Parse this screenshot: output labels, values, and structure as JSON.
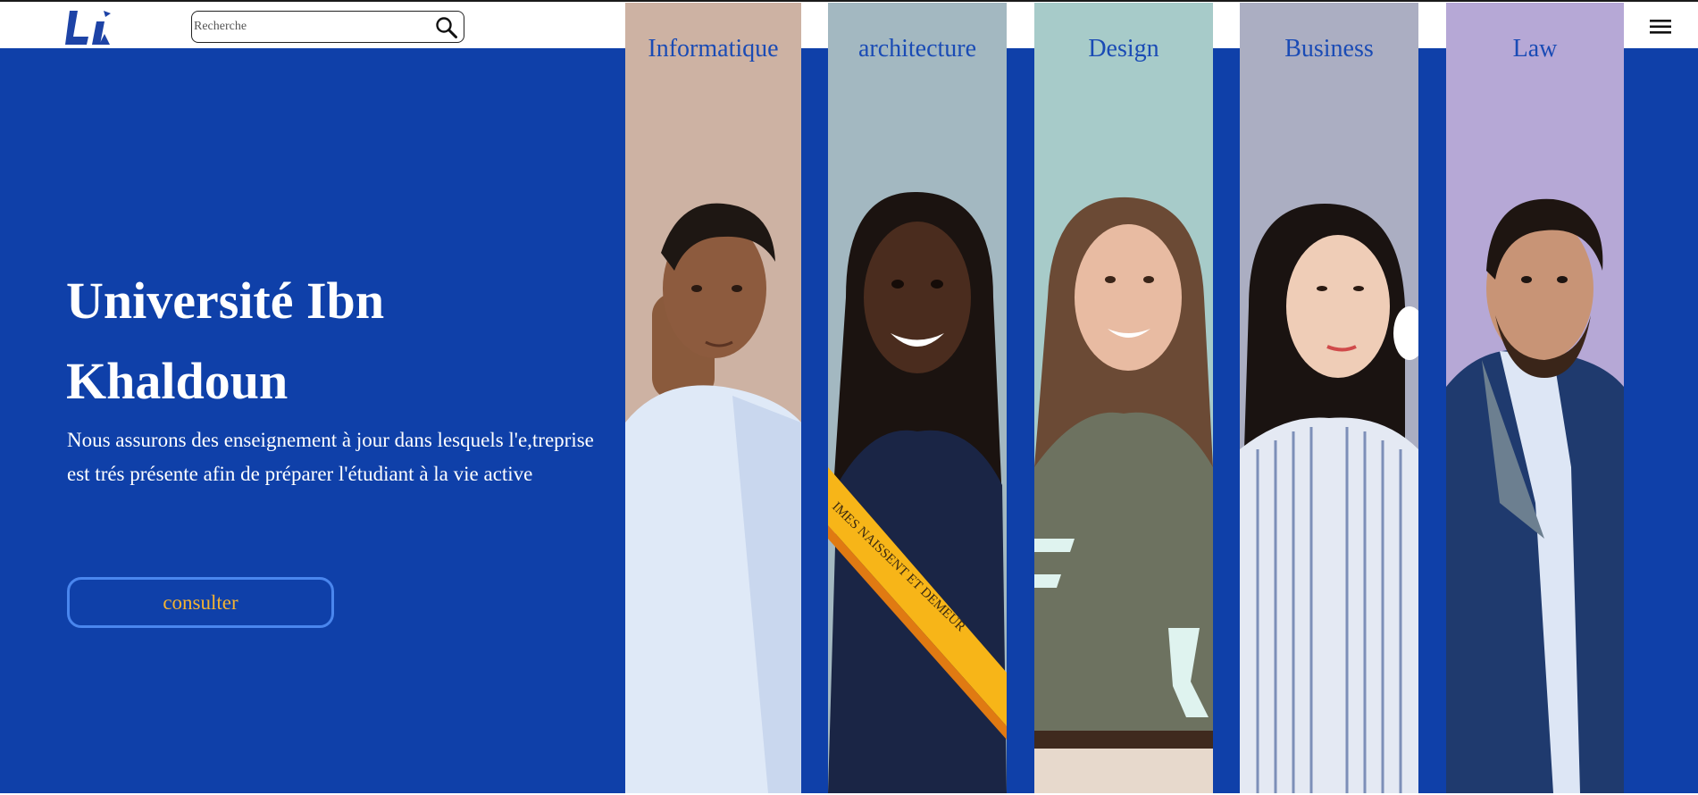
{
  "header": {
    "logo_alt": "Université Ibn Khaldoun logo",
    "search": {
      "placeholder": "Recherche",
      "value": ""
    }
  },
  "hero": {
    "title": "Université Ibn Khaldoun",
    "description": "Nous assurons des enseignement à jour dans lesquels l'e,treprise est trés présente afin de préparer l'étudiant à la vie active",
    "button_label": "consulter"
  },
  "columns": [
    {
      "label": "Informatique",
      "bg": "#cdb2a3"
    },
    {
      "label": "architecture",
      "bg": "#a3b8c1"
    },
    {
      "label": "Design",
      "bg": "#a7cbc9"
    },
    {
      "label": "Business",
      "bg": "#abaec2"
    },
    {
      "label": "Law",
      "bg": "#b6a8d6"
    }
  ],
  "photo_text": "IMES NAISSENT ET DEMEUR",
  "colors": {
    "brand_blue": "#0f40a9",
    "button_border": "#4a86ee",
    "button_text": "#f2b233",
    "column_label": "#1a4bb5"
  },
  "icons": {
    "search": "search-icon",
    "menu": "menu-icon"
  }
}
